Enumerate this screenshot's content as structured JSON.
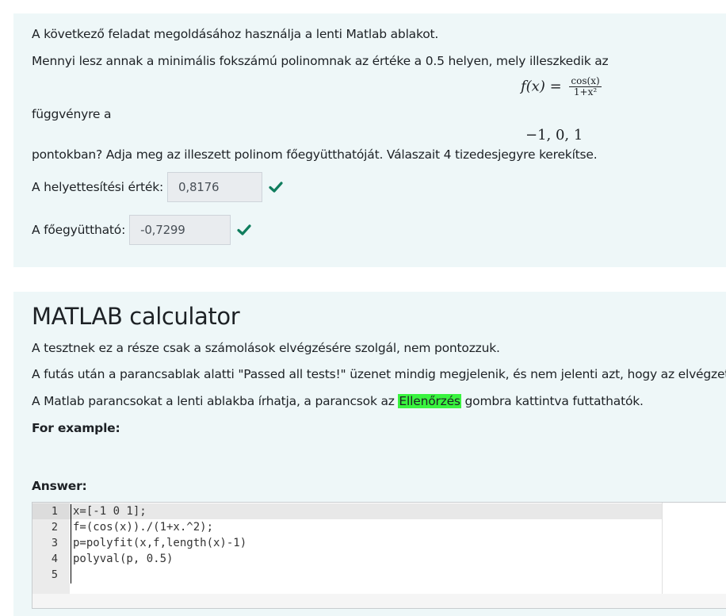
{
  "question": {
    "intro": "A következő feladat megoldásához használja a lenti Matlab ablakot.",
    "line2": "Mennyi lesz annak a minimális fokszámú polinomnak az értéke a 0.5 helyen, mely illeszkedik az",
    "formula_lhs": "f(x) =",
    "formula_num": "cos(x)",
    "formula_den": "1+x²",
    "line3": "függvényre a",
    "points": "−1,   0,   1",
    "line4": "pontokban? Adja meg az illeszett polinom  főegyütthatóját. Válaszait 4 tizedesjegyre kerekítse.",
    "answers": [
      {
        "label": "A helyettesítési érték:",
        "value": "0,8176",
        "correct": true
      },
      {
        "label": "A főegyüttható:",
        "value": "-0,7299",
        "correct": true
      }
    ]
  },
  "calculator": {
    "title": "MATLAB calculator",
    "p1": "A tesztnek ez a része csak a számolások elvégzésére szolgál, nem pontozzuk.",
    "p2": "A futás után a parancsablak alatti \"Passed all tests!\" üzenet mindig megjelenik, és nem jelenti azt, hogy az elvégzett számolás helyes.",
    "p3_before": "A Matlab parancsokat a lenti ablakba írhatja, a parancsok az ",
    "p3_highlight": "Ellenőrzés",
    "p3_after": " gombra kattintva futtathatók.",
    "for_example": "For example:",
    "answer_label": "Answer:",
    "code_lines": [
      "x=[-1 0 1];",
      "f=(cos(x))./(1+x.^2);",
      "p=polyfit(x,f,length(x)-1)",
      "polyval(p, 0.5)",
      ""
    ],
    "line_numbers": [
      "1",
      "2",
      "3",
      "4",
      "5"
    ]
  },
  "colors": {
    "panel_bg": "#eef7f8",
    "check": "#0f7d5d",
    "highlight": "#39f43f"
  }
}
